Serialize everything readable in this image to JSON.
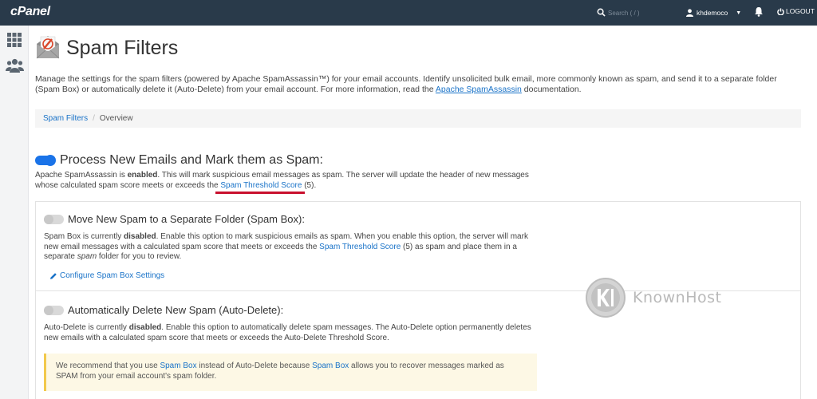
{
  "topbar": {
    "logo": "cPanel",
    "search_placeholder": "Search ( / )",
    "username": "khdemoco",
    "logout_label": "LOGOUT"
  },
  "page": {
    "title": "Spam Filters",
    "description_part1": "Manage the settings for the spam filters (powered by Apache SpamAssassin™) for your email accounts. Identify unsolicited bulk email, more commonly known as spam, and send it to a separate folder (Spam Box) or automatically delete it (Auto-Delete) from your email account. For more information, read the ",
    "description_link": "Apache SpamAssassin",
    "description_part2": " documentation."
  },
  "breadcrumb": {
    "parent": "Spam Filters",
    "separator": "/",
    "current": "Overview"
  },
  "process": {
    "title": "Process New Emails and Mark them as Spam:",
    "text_part1": "Apache SpamAssassin is ",
    "text_bold": "enabled",
    "text_part2": ". This will mark suspicious email messages as spam. The server will update the header of new messages whose calculated spam score meets or exceeds the ",
    "link": "Spam Threshold Score",
    "text_part3": " (5)."
  },
  "spambox": {
    "title": "Move New Spam to a Separate Folder (Spam Box):",
    "text_part1": "Spam Box is currently ",
    "text_bold": "disabled",
    "text_part2": ". Enable this option to mark suspicious emails as spam. When you enable this option, the server will mark new email messages with a calculated spam score that meets or exceeds the ",
    "link": "Spam Threshold Score",
    "text_part3": " (5) as spam and place them in a separate ",
    "text_italic": "spam",
    "text_part4": " folder for you to review.",
    "config_link": "Configure Spam Box Settings"
  },
  "autodelete": {
    "title": "Automatically Delete New Spam (Auto-Delete):",
    "text_part1": "Auto-Delete is currently ",
    "text_bold": "disabled",
    "text_part2": ". Enable this option to automatically delete spam messages. The Auto-Delete option permanently deletes new emails with a calculated spam score that meets or exceeds the Auto-Delete Threshold Score."
  },
  "alert": {
    "part1": "We recommend that you use ",
    "link1": "Spam Box",
    "part2": " instead of Auto-Delete because ",
    "link2": "Spam Box",
    "part3": " allows you to recover messages marked as SPAM from your email account's spam folder."
  },
  "watermark": {
    "text": "KnownHost"
  },
  "colors": {
    "topbar": "#293a4a",
    "link": "#1a73c8",
    "toggle_on": "#1a73e8",
    "highlight_underline": "#c8102e",
    "alert_bg": "#fdf8e5"
  }
}
